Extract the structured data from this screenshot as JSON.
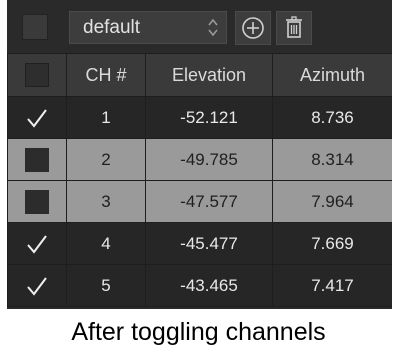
{
  "toolbar": {
    "preset_value": "default"
  },
  "table": {
    "columns": [
      "CH #",
      "Elevation",
      "Azimuth"
    ],
    "rows": [
      {
        "checked": true,
        "ch": "1",
        "elevation": "-52.121",
        "azimuth": "8.736"
      },
      {
        "checked": false,
        "ch": "2",
        "elevation": "-49.785",
        "azimuth": "8.314"
      },
      {
        "checked": false,
        "ch": "3",
        "elevation": "-47.577",
        "azimuth": "7.964"
      },
      {
        "checked": true,
        "ch": "4",
        "elevation": "-45.477",
        "azimuth": "7.669"
      },
      {
        "checked": true,
        "ch": "5",
        "elevation": "-43.465",
        "azimuth": "7.417"
      }
    ]
  },
  "caption": "After toggling channels",
  "colors": {
    "panel": "#2a2a2a",
    "header": "#3a3a3a",
    "selected_row": "#9a9a9a",
    "text": "#e8e8e8"
  }
}
